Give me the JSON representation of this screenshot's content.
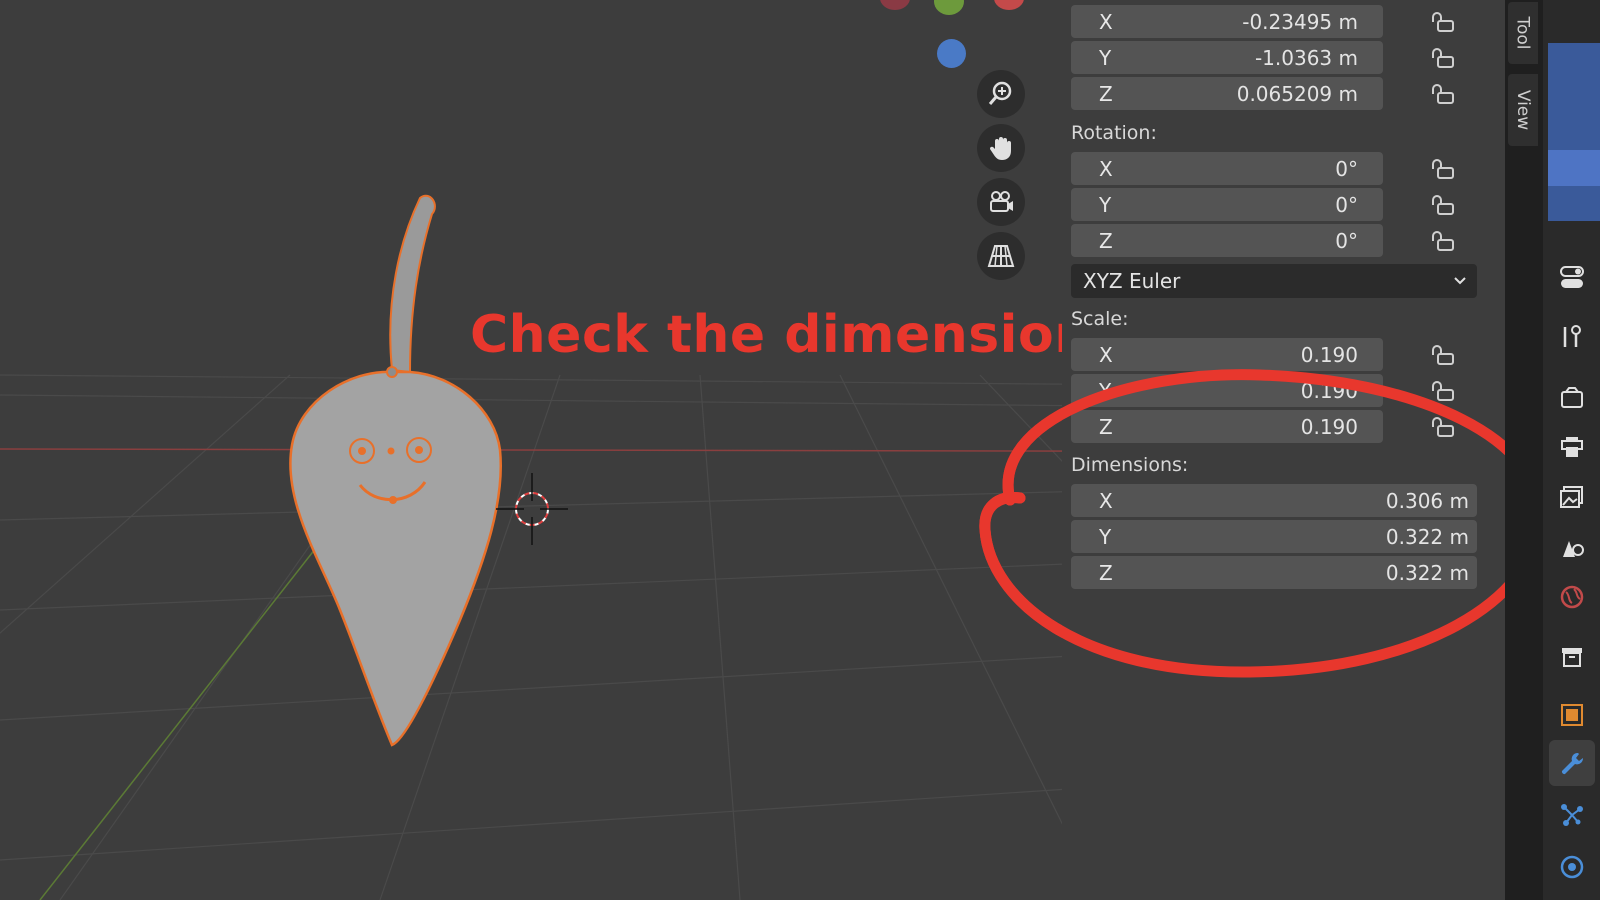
{
  "annotation": {
    "text": "Check the dimensions"
  },
  "location": {
    "x": {
      "label": "X",
      "value": "-0.23495 m"
    },
    "y": {
      "label": "Y",
      "value": "-1.0363 m"
    },
    "z": {
      "label": "Z",
      "value": "0.065209 m"
    }
  },
  "rotation": {
    "label": "Rotation:",
    "x": {
      "label": "X",
      "value": "0°"
    },
    "y": {
      "label": "Y",
      "value": "0°"
    },
    "z": {
      "label": "Z",
      "value": "0°"
    },
    "mode": "XYZ Euler"
  },
  "scale": {
    "label": "Scale:",
    "x": {
      "label": "X",
      "value": "0.190"
    },
    "y": {
      "label": "Y",
      "value": "0.190"
    },
    "z": {
      "label": "Z",
      "value": "0.190"
    }
  },
  "dimensions": {
    "label": "Dimensions:",
    "x": {
      "label": "X",
      "value": "0.306 m"
    },
    "y": {
      "label": "Y",
      "value": "0.322 m"
    },
    "z": {
      "label": "Z",
      "value": "0.322 m"
    }
  },
  "tabs": {
    "tool": "Tool",
    "view": "View"
  },
  "colors": {
    "annotation": "#e8372d",
    "selection_outline": "#e8702a",
    "axis_x": "#c44a4a",
    "axis_y": "#6d9a3c",
    "axis_z": "#4a7ac6"
  }
}
